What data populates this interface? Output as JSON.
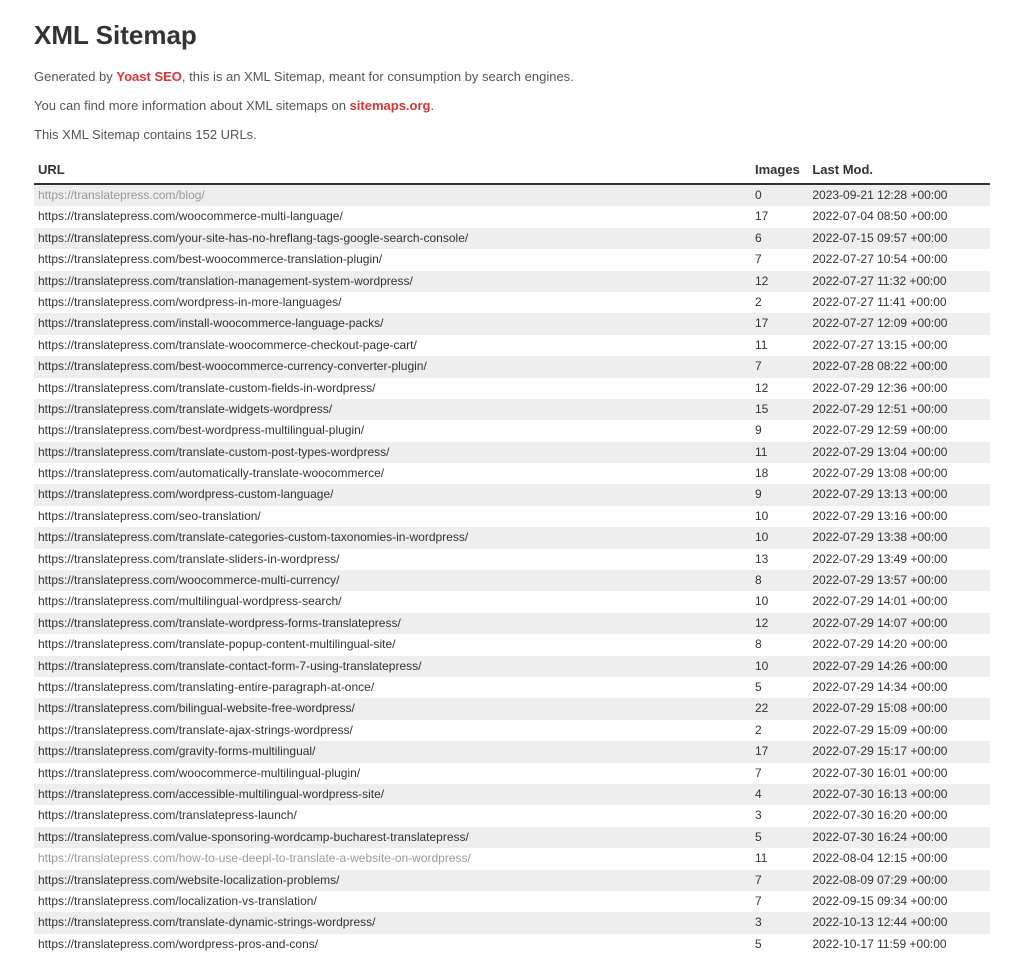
{
  "title": "XML Sitemap",
  "intro": {
    "generated_prefix": "Generated by ",
    "brand": "Yoast SEO",
    "generated_suffix": ", this is an XML Sitemap, meant for consumption by search engines.",
    "more_info_prefix": "You can find more information about XML sitemaps on ",
    "more_info_link": "sitemaps.org",
    "more_info_suffix": ".",
    "count_line": "This XML Sitemap contains 152 URLs."
  },
  "headers": {
    "url": "URL",
    "images": "Images",
    "lastmod": "Last Mod."
  },
  "rows": [
    {
      "url": "https://translatepress.com/blog/",
      "images": "0",
      "lastmod": "2023-09-21 12:28 +00:00",
      "muted": true
    },
    {
      "url": "https://translatepress.com/woocommerce-multi-language/",
      "images": "17",
      "lastmod": "2022-07-04 08:50 +00:00"
    },
    {
      "url": "https://translatepress.com/your-site-has-no-hreflang-tags-google-search-console/",
      "images": "6",
      "lastmod": "2022-07-15 09:57 +00:00"
    },
    {
      "url": "https://translatepress.com/best-woocommerce-translation-plugin/",
      "images": "7",
      "lastmod": "2022-07-27 10:54 +00:00"
    },
    {
      "url": "https://translatepress.com/translation-management-system-wordpress/",
      "images": "12",
      "lastmod": "2022-07-27 11:32 +00:00"
    },
    {
      "url": "https://translatepress.com/wordpress-in-more-languages/",
      "images": "2",
      "lastmod": "2022-07-27 11:41 +00:00"
    },
    {
      "url": "https://translatepress.com/install-woocommerce-language-packs/",
      "images": "17",
      "lastmod": "2022-07-27 12:09 +00:00"
    },
    {
      "url": "https://translatepress.com/translate-woocommerce-checkout-page-cart/",
      "images": "11",
      "lastmod": "2022-07-27 13:15 +00:00"
    },
    {
      "url": "https://translatepress.com/best-woocommerce-currency-converter-plugin/",
      "images": "7",
      "lastmod": "2022-07-28 08:22 +00:00"
    },
    {
      "url": "https://translatepress.com/translate-custom-fields-in-wordpress/",
      "images": "12",
      "lastmod": "2022-07-29 12:36 +00:00"
    },
    {
      "url": "https://translatepress.com/translate-widgets-wordpress/",
      "images": "15",
      "lastmod": "2022-07-29 12:51 +00:00"
    },
    {
      "url": "https://translatepress.com/best-wordpress-multilingual-plugin/",
      "images": "9",
      "lastmod": "2022-07-29 12:59 +00:00"
    },
    {
      "url": "https://translatepress.com/translate-custom-post-types-wordpress/",
      "images": "11",
      "lastmod": "2022-07-29 13:04 +00:00"
    },
    {
      "url": "https://translatepress.com/automatically-translate-woocommerce/",
      "images": "18",
      "lastmod": "2022-07-29 13:08 +00:00"
    },
    {
      "url": "https://translatepress.com/wordpress-custom-language/",
      "images": "9",
      "lastmod": "2022-07-29 13:13 +00:00"
    },
    {
      "url": "https://translatepress.com/seo-translation/",
      "images": "10",
      "lastmod": "2022-07-29 13:16 +00:00"
    },
    {
      "url": "https://translatepress.com/translate-categories-custom-taxonomies-in-wordpress/",
      "images": "10",
      "lastmod": "2022-07-29 13:38 +00:00"
    },
    {
      "url": "https://translatepress.com/translate-sliders-in-wordpress/",
      "images": "13",
      "lastmod": "2022-07-29 13:49 +00:00"
    },
    {
      "url": "https://translatepress.com/woocommerce-multi-currency/",
      "images": "8",
      "lastmod": "2022-07-29 13:57 +00:00"
    },
    {
      "url": "https://translatepress.com/multilingual-wordpress-search/",
      "images": "10",
      "lastmod": "2022-07-29 14:01 +00:00"
    },
    {
      "url": "https://translatepress.com/translate-wordpress-forms-translatepress/",
      "images": "12",
      "lastmod": "2022-07-29 14:07 +00:00"
    },
    {
      "url": "https://translatepress.com/translate-popup-content-multilingual-site/",
      "images": "8",
      "lastmod": "2022-07-29 14:20 +00:00"
    },
    {
      "url": "https://translatepress.com/translate-contact-form-7-using-translatepress/",
      "images": "10",
      "lastmod": "2022-07-29 14:26 +00:00"
    },
    {
      "url": "https://translatepress.com/translating-entire-paragraph-at-once/",
      "images": "5",
      "lastmod": "2022-07-29 14:34 +00:00"
    },
    {
      "url": "https://translatepress.com/bilingual-website-free-wordpress/",
      "images": "22",
      "lastmod": "2022-07-29 15:08 +00:00"
    },
    {
      "url": "https://translatepress.com/translate-ajax-strings-wordpress/",
      "images": "2",
      "lastmod": "2022-07-29 15:09 +00:00"
    },
    {
      "url": "https://translatepress.com/gravity-forms-multilingual/",
      "images": "17",
      "lastmod": "2022-07-29 15:17 +00:00"
    },
    {
      "url": "https://translatepress.com/woocommerce-multilingual-plugin/",
      "images": "7",
      "lastmod": "2022-07-30 16:01 +00:00"
    },
    {
      "url": "https://translatepress.com/accessible-multilingual-wordpress-site/",
      "images": "4",
      "lastmod": "2022-07-30 16:13 +00:00"
    },
    {
      "url": "https://translatepress.com/translatepress-launch/",
      "images": "3",
      "lastmod": "2022-07-30 16:20 +00:00"
    },
    {
      "url": "https://translatepress.com/value-sponsoring-wordcamp-bucharest-translatepress/",
      "images": "5",
      "lastmod": "2022-07-30 16:24 +00:00"
    },
    {
      "url": "https://translatepress.com/how-to-use-deepl-to-translate-a-website-on-wordpress/",
      "images": "11",
      "lastmod": "2022-08-04 12:15 +00:00",
      "muted": true
    },
    {
      "url": "https://translatepress.com/website-localization-problems/",
      "images": "7",
      "lastmod": "2022-08-09 07:29 +00:00"
    },
    {
      "url": "https://translatepress.com/localization-vs-translation/",
      "images": "7",
      "lastmod": "2022-09-15 09:34 +00:00"
    },
    {
      "url": "https://translatepress.com/translate-dynamic-strings-wordpress/",
      "images": "3",
      "lastmod": "2022-10-13 12:44 +00:00"
    },
    {
      "url": "https://translatepress.com/wordpress-pros-and-cons/",
      "images": "5",
      "lastmod": "2022-10-17 11:59 +00:00"
    }
  ]
}
